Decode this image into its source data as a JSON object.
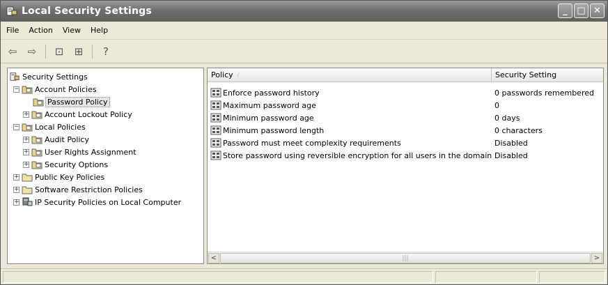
{
  "window": {
    "title": "Local Security Settings",
    "title_icon": "security-settings-icon",
    "controls": [
      {
        "name": "minimize",
        "glyph": "_"
      },
      {
        "name": "maximize",
        "glyph": "□"
      },
      {
        "name": "close",
        "glyph": "✕"
      }
    ]
  },
  "menu": {
    "items": [
      "File",
      "Action",
      "View",
      "Help"
    ]
  },
  "toolbar": {
    "buttons": [
      {
        "icon": "back-arrow-icon",
        "glyph": "⇦"
      },
      {
        "icon": "forward-arrow-icon",
        "glyph": "⇨"
      },
      {
        "icon": "up-folder-icon",
        "glyph": "⊡"
      },
      {
        "icon": "export-list-icon",
        "glyph": "⊞"
      },
      {
        "icon": "help-icon",
        "glyph": "?"
      }
    ]
  },
  "tree": {
    "nodes": [
      {
        "label": "Security Settings",
        "depth": 0,
        "expander": "",
        "icon": "security-settings-icon"
      },
      {
        "label": "Account Policies",
        "depth": 1,
        "expander": "−",
        "icon": "policy-folder-icon"
      },
      {
        "label": "Password Policy",
        "depth": 2,
        "expander": "",
        "icon": "policy-folder-icon",
        "selected": true
      },
      {
        "label": "Account Lockout Policy",
        "depth": 2,
        "expander": "+",
        "icon": "policy-folder-icon"
      },
      {
        "label": "Local Policies",
        "depth": 1,
        "expander": "−",
        "icon": "policy-folder-icon"
      },
      {
        "label": "Audit Policy",
        "depth": 2,
        "expander": "+",
        "icon": "policy-folder-icon"
      },
      {
        "label": "User Rights Assignment",
        "depth": 2,
        "expander": "+",
        "icon": "policy-folder-icon"
      },
      {
        "label": "Security Options",
        "depth": 2,
        "expander": "+",
        "icon": "policy-folder-icon"
      },
      {
        "label": "Public Key Policies",
        "depth": 1,
        "expander": "+",
        "icon": "folder-icon"
      },
      {
        "label": "Software Restriction Policies",
        "depth": 1,
        "expander": "+",
        "icon": "folder-icon"
      },
      {
        "label": "IP Security Policies on Local Computer",
        "depth": 1,
        "expander": "+",
        "icon": "ip-security-icon"
      }
    ]
  },
  "list": {
    "columns": [
      "Policy",
      "Security Setting"
    ],
    "sort_arrow": "/",
    "rows": [
      {
        "policy": "Enforce password history",
        "setting": "0 passwords remembered"
      },
      {
        "policy": "Maximum password age",
        "setting": "0"
      },
      {
        "policy": "Minimum password age",
        "setting": "0 days"
      },
      {
        "policy": "Minimum password length",
        "setting": "0 characters"
      },
      {
        "policy": "Password must meet complexity requirements",
        "setting": "Disabled"
      },
      {
        "policy": "Store password using reversible encryption for all users in the domain",
        "setting": "Disabled"
      }
    ],
    "scrollbar": {
      "left_arrow": "<",
      "right_arrow": ">",
      "thumb_grip": "|||"
    }
  },
  "colors": {
    "titlebar": "#6f6f6f",
    "window_bg": "#ece9d8",
    "pane_bg": "#ffffff"
  }
}
